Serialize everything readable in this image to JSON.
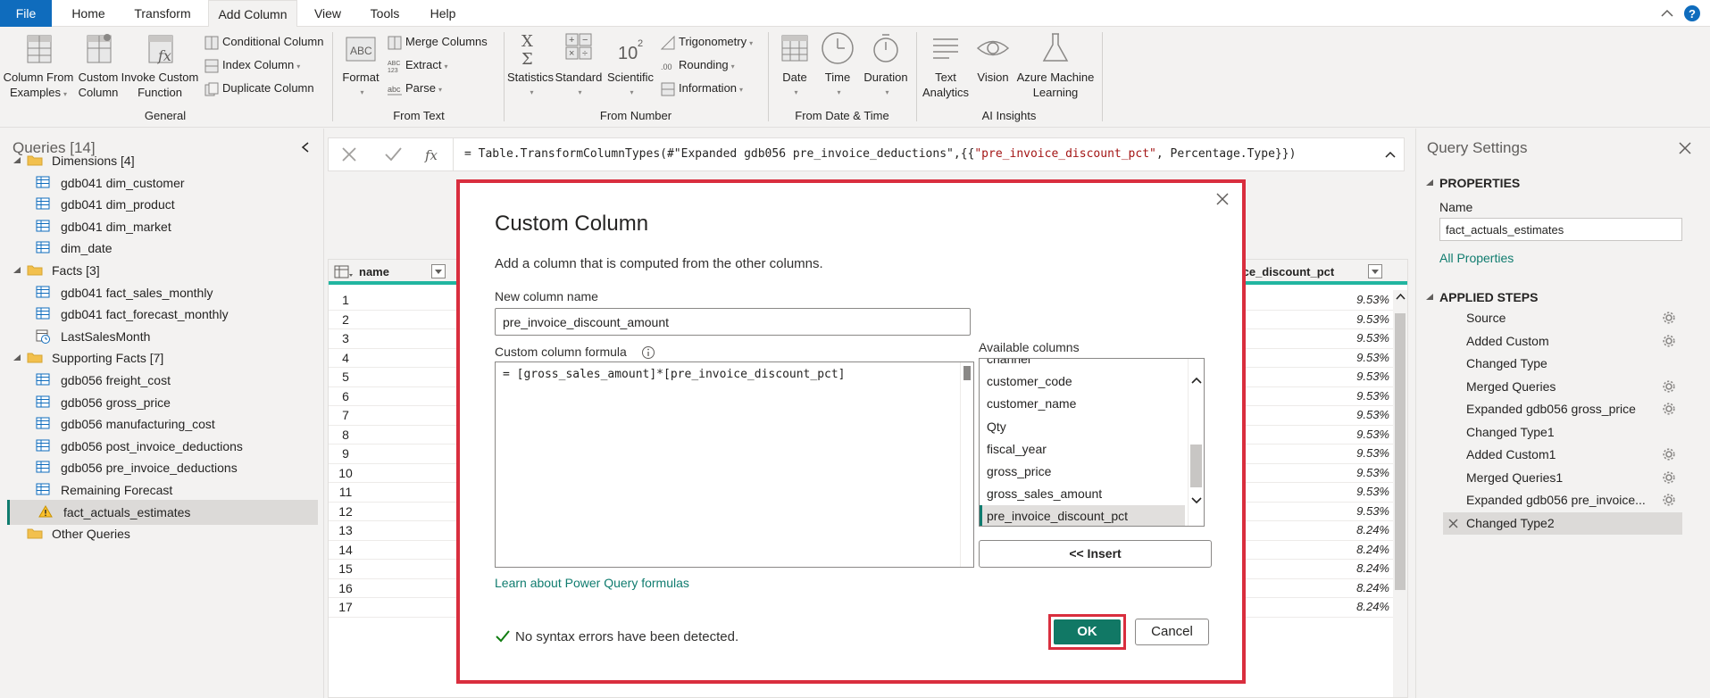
{
  "menu": {
    "tabs": [
      "File",
      "Home",
      "Transform",
      "Add Column",
      "View",
      "Tools",
      "Help"
    ],
    "active": "Add Column"
  },
  "ribbon": {
    "general": {
      "label": "General",
      "col_from_examples": [
        "Column From",
        "Examples"
      ],
      "custom_column": [
        "Custom",
        "Column"
      ],
      "invoke_custom_function": [
        "Invoke Custom",
        "Function"
      ],
      "conditional_column": "Conditional Column",
      "index_column": "Index Column",
      "duplicate_column": "Duplicate Column"
    },
    "from_text": {
      "label": "From Text",
      "format": "Format",
      "merge_columns": "Merge Columns",
      "extract": "Extract",
      "parse": "Parse"
    },
    "from_number": {
      "label": "From Number",
      "statistics": "Statistics",
      "standard": "Standard",
      "scientific": "Scientific",
      "trigonometry": "Trigonometry",
      "rounding": "Rounding",
      "information": "Information"
    },
    "from_date_time": {
      "label": "From Date & Time",
      "date": "Date",
      "time": "Time",
      "duration": "Duration"
    },
    "ai_insights": {
      "label": "AI Insights",
      "text_analytics": [
        "Text",
        "Analytics"
      ],
      "vision": "Vision",
      "azure_ml": [
        "Azure Machine",
        "Learning"
      ]
    }
  },
  "queries": {
    "title": "Queries [14]",
    "items": [
      {
        "type": "folder",
        "label": "Dimensions [4]",
        "indent": 0
      },
      {
        "type": "table",
        "label": "gdb041 dim_customer",
        "indent": 1
      },
      {
        "type": "table",
        "label": "gdb041 dim_product",
        "indent": 1
      },
      {
        "type": "table",
        "label": "gdb041 dim_market",
        "indent": 1
      },
      {
        "type": "table",
        "label": "dim_date",
        "indent": 1
      },
      {
        "type": "folder",
        "label": "Facts [3]",
        "indent": 0
      },
      {
        "type": "table",
        "label": "gdb041 fact_sales_monthly",
        "indent": 1
      },
      {
        "type": "table",
        "label": "gdb041 fact_forecast_monthly",
        "indent": 1
      },
      {
        "type": "param",
        "label": "LastSalesMonth",
        "indent": 1
      },
      {
        "type": "folder",
        "label": "Supporting Facts [7]",
        "indent": 0
      },
      {
        "type": "table",
        "label": "gdb056 freight_cost",
        "indent": 1
      },
      {
        "type": "table",
        "label": "gdb056 gross_price",
        "indent": 1
      },
      {
        "type": "table",
        "label": "gdb056 manufacturing_cost",
        "indent": 1
      },
      {
        "type": "table",
        "label": "gdb056 post_invoice_deductions",
        "indent": 1
      },
      {
        "type": "table",
        "label": "gdb056 pre_invoice_deductions",
        "indent": 1
      },
      {
        "type": "table",
        "label": "Remaining Forecast",
        "indent": 1
      },
      {
        "type": "warning",
        "label": "fact_actuals_estimates",
        "indent": 1,
        "selected": true
      },
      {
        "type": "folder-noarrow",
        "label": "Other Queries",
        "indent": 0
      }
    ]
  },
  "formula_bar": {
    "prefix": "= Table.TransformColumnTypes(#\"Expanded gdb056 pre_invoice_deductions\",{{",
    "string": "\"pre_invoice_discount_pct\"",
    "suffix": ", Percentage.Type}})"
  },
  "grid": {
    "left_col_header": "name",
    "right_col_header": "ice_discount_pct",
    "row_numbers": [
      "1",
      "2",
      "3",
      "4",
      "5",
      "6",
      "7",
      "8",
      "9",
      "10",
      "11",
      "12",
      "13",
      "14",
      "15",
      "16",
      "17"
    ],
    "pct_values": [
      "9.53%",
      "9.53%",
      "9.53%",
      "9.53%",
      "9.53%",
      "9.53%",
      "9.53%",
      "9.53%",
      "9.53%",
      "9.53%",
      "9.53%",
      "9.53%",
      "8.24%",
      "8.24%",
      "8.24%",
      "8.24%",
      "8.24%"
    ]
  },
  "query_settings": {
    "title": "Query Settings",
    "properties_title": "PROPERTIES",
    "name_label": "Name",
    "name_value": "fact_actuals_estimates",
    "all_properties": "All Properties",
    "applied_steps_title": "APPLIED STEPS",
    "steps": [
      {
        "label": "Source",
        "gear": true
      },
      {
        "label": "Added Custom",
        "gear": true
      },
      {
        "label": "Changed Type",
        "gear": false
      },
      {
        "label": "Merged Queries",
        "gear": true
      },
      {
        "label": "Expanded gdb056 gross_price",
        "gear": true
      },
      {
        "label": "Changed Type1",
        "gear": false
      },
      {
        "label": "Added Custom1",
        "gear": true
      },
      {
        "label": "Merged Queries1",
        "gear": true
      },
      {
        "label": "Expanded gdb056 pre_invoice...",
        "gear": true
      },
      {
        "label": "Changed Type2",
        "gear": false,
        "selected": true
      }
    ]
  },
  "dialog": {
    "title": "Custom Column",
    "description": "Add a column that is computed from the other columns.",
    "new_column_label": "New column name",
    "new_column_value": "pre_invoice_discount_amount",
    "formula_label": "Custom column formula",
    "formula_value": "= [gross_sales_amount]*[pre_invoice_discount_pct]",
    "available_label": "Available columns",
    "available_columns": [
      "channel",
      "customer_code",
      "customer_name",
      "Qty",
      "fiscal_year",
      "gross_price",
      "gross_sales_amount",
      "pre_invoice_discount_pct"
    ],
    "selected_column": "pre_invoice_discount_pct",
    "insert_label": "<< Insert",
    "learn_link": "Learn about Power Query formulas",
    "syntax_message": "No syntax errors have been detected.",
    "ok_label": "OK",
    "cancel_label": "Cancel"
  },
  "colors": {
    "accent": "#107c6f",
    "highlight_border": "#d92e3e",
    "file_tab": "#0f6cbd",
    "ok_button": "#117865"
  }
}
